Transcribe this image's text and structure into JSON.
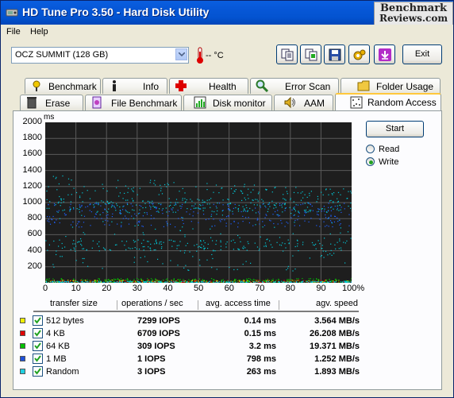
{
  "window": {
    "title": "HD Tune Pro 3.50 - Hard Disk Utility",
    "watermark_line1": "Benchmark",
    "watermark_line2": "Reviews.com"
  },
  "menu": [
    {
      "label": "File"
    },
    {
      "label": "Help"
    }
  ],
  "toolbar": {
    "drive": "OCZ SUMMIT (128 GB)",
    "temperature": "-- °C",
    "exit_label": "Exit",
    "buttons": [
      {
        "name": "copy-text-icon"
      },
      {
        "name": "copy-screenshot-icon"
      },
      {
        "name": "save-icon"
      },
      {
        "name": "options-icon"
      },
      {
        "name": "download-icon"
      }
    ]
  },
  "tabs_row1": [
    {
      "label": "Benchmark",
      "icon": "benchmark-icon"
    },
    {
      "label": "Info",
      "icon": "info-icon"
    },
    {
      "label": "Health",
      "icon": "health-icon"
    },
    {
      "label": "Error Scan",
      "icon": "error-scan-icon"
    },
    {
      "label": "Folder Usage",
      "icon": "folder-icon"
    }
  ],
  "tabs_row2": [
    {
      "label": "Erase",
      "icon": "trash-icon"
    },
    {
      "label": "File Benchmark",
      "icon": "file-benchmark-icon"
    },
    {
      "label": "Disk monitor",
      "icon": "disk-monitor-icon"
    },
    {
      "label": "AAM",
      "icon": "speaker-icon"
    },
    {
      "label": "Random Access",
      "icon": "random-access-icon",
      "active": true
    }
  ],
  "controls": {
    "start_label": "Start",
    "radio_read": "Read",
    "radio_write": "Write",
    "selected": "Write"
  },
  "chart_data": {
    "type": "scatter",
    "ylabel": "ms",
    "ylim": [
      0,
      2000
    ],
    "xlim": [
      0,
      100
    ],
    "y_ticks": [
      "2000",
      "1800",
      "1600",
      "1400",
      "1200",
      "1000",
      "800",
      "600",
      "400",
      "200"
    ],
    "x_ticks": [
      "0",
      "10",
      "20",
      "30",
      "40",
      "50",
      "60",
      "70",
      "80",
      "90",
      "100%"
    ],
    "grid": true,
    "background": "#1e1e1e",
    "series": [
      {
        "name": "512 bytes",
        "color": "#e8e800",
        "band": [
          0,
          40
        ]
      },
      {
        "name": "4 KB",
        "color": "#e00000",
        "band": [
          0,
          40
        ]
      },
      {
        "name": "64 KB",
        "color": "#00c000",
        "band": [
          0,
          60
        ]
      },
      {
        "name": "1 MB",
        "color": "#2060ff",
        "band": [
          700,
          1000
        ]
      },
      {
        "name": "Random",
        "color": "#00c8d8",
        "band": [
          0,
          1300
        ]
      }
    ]
  },
  "results": {
    "headers": [
      "transfer size",
      "operations / sec",
      "avg. access time",
      "agv. speed"
    ],
    "rows": [
      {
        "label": "512 bytes",
        "color": "#f0f000",
        "ops": "7299 IOPS",
        "access": "0.14 ms",
        "speed": "3.564 MB/s"
      },
      {
        "label": "4 KB",
        "color": "#e00000",
        "ops": "6709 IOPS",
        "access": "0.15 ms",
        "speed": "26.208 MB/s"
      },
      {
        "label": "64 KB",
        "color": "#00c000",
        "ops": "309 IOPS",
        "access": "3.2 ms",
        "speed": "19.371 MB/s"
      },
      {
        "label": "1 MB",
        "color": "#1e4fd8",
        "ops": "1 IOPS",
        "access": "798 ms",
        "speed": "1.252 MB/s"
      },
      {
        "label": "Random",
        "color": "#20d0e0",
        "ops": "3 IOPS",
        "access": "263 ms",
        "speed": "1.893 MB/s"
      }
    ]
  }
}
